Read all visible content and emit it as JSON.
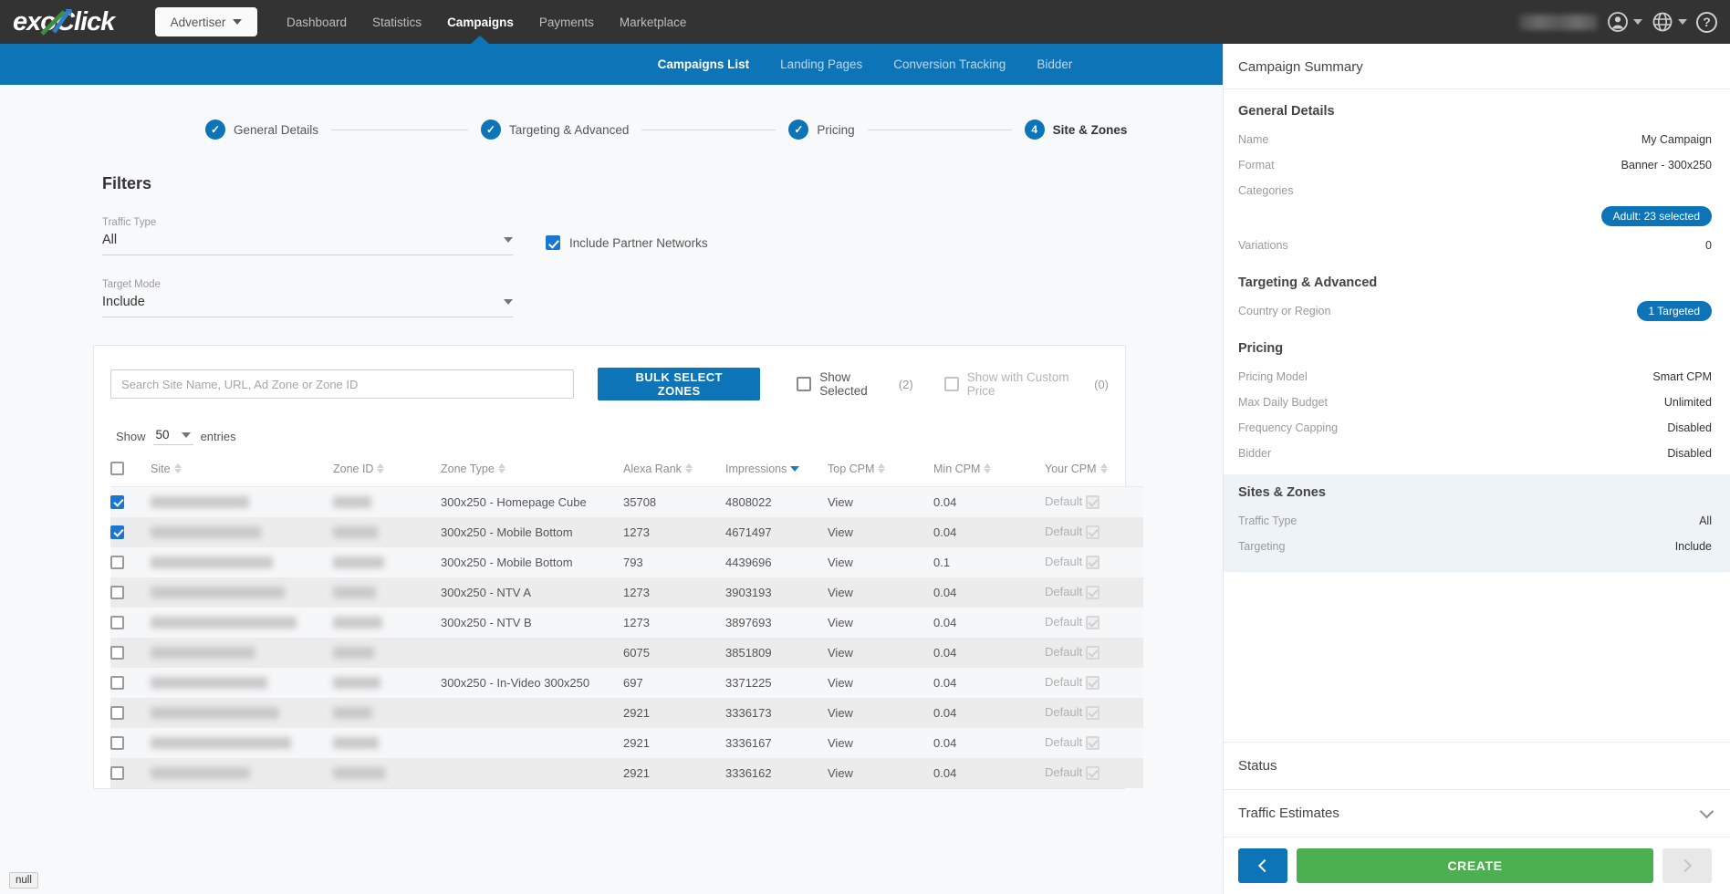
{
  "brand": {
    "logo_text": "exoClick",
    "accent": "#0d74b8",
    "create_green": "#4caf50"
  },
  "topbar": {
    "account_type": "Advertiser",
    "nav": [
      {
        "label": "Dashboard",
        "active": false
      },
      {
        "label": "Statistics",
        "active": false
      },
      {
        "label": "Campaigns",
        "active": true
      },
      {
        "label": "Payments",
        "active": false
      },
      {
        "label": "Marketplace",
        "active": false
      }
    ],
    "user_name_redacted": "",
    "icons": {
      "account": "account-circle-icon",
      "language": "globe-icon",
      "help": "help-circle-icon"
    }
  },
  "subnav": {
    "tabs": [
      {
        "label": "Campaigns List",
        "active": true
      },
      {
        "label": "Landing Pages",
        "active": false
      },
      {
        "label": "Conversion Tracking",
        "active": false
      },
      {
        "label": "Bidder",
        "active": false
      }
    ]
  },
  "stepper": {
    "steps": [
      {
        "label": "General Details",
        "state": "complete",
        "mark": "✓"
      },
      {
        "label": "Targeting & Advanced",
        "state": "complete",
        "mark": "✓"
      },
      {
        "label": "Pricing",
        "state": "complete",
        "mark": "✓"
      },
      {
        "label": "Site & Zones",
        "state": "active",
        "mark": "4"
      }
    ]
  },
  "filters": {
    "title": "Filters",
    "traffic_type": {
      "label": "Traffic Type",
      "value": "All"
    },
    "target_mode": {
      "label": "Target Mode",
      "value": "Include"
    },
    "include_partner_networks": {
      "label": "Include Partner Networks",
      "checked": true
    }
  },
  "zones_card": {
    "search": {
      "placeholder": "Search Site Name, URL, Ad Zone or Zone ID",
      "value": ""
    },
    "bulk_button": "BULK SELECT ZONES",
    "show_selected": {
      "label": "Show Selected",
      "count": "(2)",
      "checked": false
    },
    "show_custom_price": {
      "label": "Show with Custom Price",
      "count": "(0)",
      "checked": false
    },
    "show_entries": {
      "prefix": "Show",
      "value": "50",
      "suffix": "entries"
    },
    "columns": [
      {
        "key": "checkbox",
        "label": ""
      },
      {
        "key": "site",
        "label": "Site",
        "sort": "none"
      },
      {
        "key": "zone_id",
        "label": "Zone ID",
        "sort": "none"
      },
      {
        "key": "zone_type",
        "label": "Zone Type",
        "sort": "none"
      },
      {
        "key": "alexa_rank",
        "label": "Alexa Rank",
        "sort": "none"
      },
      {
        "key": "impressions",
        "label": "Impressions",
        "sort": "desc"
      },
      {
        "key": "top_cpm",
        "label": "Top CPM",
        "sort": "none"
      },
      {
        "key": "min_cpm",
        "label": "Min CPM",
        "sort": "none"
      },
      {
        "key": "your_cpm",
        "label": "Your CPM",
        "sort": "none"
      }
    ],
    "rows": [
      {
        "selected": true,
        "site": "",
        "zone_id": "",
        "zone_type": "300x250 - Homepage Cube",
        "alexa_rank": "35708",
        "impressions": "4808022",
        "top_cpm": "View",
        "min_cpm": "0.04",
        "your_cpm": "Default"
      },
      {
        "selected": true,
        "site": "",
        "zone_id": "",
        "zone_type": "300x250 - Mobile Bottom",
        "alexa_rank": "1273",
        "impressions": "4671497",
        "top_cpm": "View",
        "min_cpm": "0.04",
        "your_cpm": "Default"
      },
      {
        "selected": false,
        "site": "",
        "zone_id": "",
        "zone_type": "300x250 - Mobile Bottom",
        "alexa_rank": "793",
        "impressions": "4439696",
        "top_cpm": "View",
        "min_cpm": "0.1",
        "your_cpm": "Default"
      },
      {
        "selected": false,
        "site": "",
        "zone_id": "",
        "zone_type": "300x250 - NTV A",
        "alexa_rank": "1273",
        "impressions": "3903193",
        "top_cpm": "View",
        "min_cpm": "0.04",
        "your_cpm": "Default"
      },
      {
        "selected": false,
        "site": "",
        "zone_id": "",
        "zone_type": "300x250 - NTV B",
        "alexa_rank": "1273",
        "impressions": "3897693",
        "top_cpm": "View",
        "min_cpm": "0.04",
        "your_cpm": "Default"
      },
      {
        "selected": false,
        "site": "",
        "zone_id": "",
        "zone_type": "",
        "alexa_rank": "6075",
        "impressions": "3851809",
        "top_cpm": "View",
        "min_cpm": "0.04",
        "your_cpm": "Default"
      },
      {
        "selected": false,
        "site": "",
        "zone_id": "",
        "zone_type": "300x250 - In-Video 300x250",
        "alexa_rank": "697",
        "impressions": "3371225",
        "top_cpm": "View",
        "min_cpm": "0.04",
        "your_cpm": "Default"
      },
      {
        "selected": false,
        "site": "",
        "zone_id": "",
        "zone_type": "",
        "alexa_rank": "2921",
        "impressions": "3336173",
        "top_cpm": "View",
        "min_cpm": "0.04",
        "your_cpm": "Default"
      },
      {
        "selected": false,
        "site": "",
        "zone_id": "",
        "zone_type": "",
        "alexa_rank": "2921",
        "impressions": "3336167",
        "top_cpm": "View",
        "min_cpm": "0.04",
        "your_cpm": "Default"
      },
      {
        "selected": false,
        "site": "",
        "zone_id": "",
        "zone_type": "",
        "alexa_rank": "2921",
        "impressions": "3336162",
        "top_cpm": "View",
        "min_cpm": "0.04",
        "your_cpm": "Default"
      }
    ]
  },
  "sidebar": {
    "title": "Campaign Summary",
    "general_details": {
      "heading": "General Details",
      "name_label": "Name",
      "name_value": "My Campaign",
      "format_label": "Format",
      "format_value": "Banner - 300x250",
      "categories_label": "Categories",
      "categories_badge": "Adult: 23 selected",
      "variations_label": "Variations",
      "variations_value": "0"
    },
    "targeting": {
      "heading": "Targeting & Advanced",
      "country_label": "Country or Region",
      "country_badge": "1 Targeted"
    },
    "pricing": {
      "heading": "Pricing",
      "rows": [
        {
          "label": "Pricing Model",
          "value": "Smart CPM"
        },
        {
          "label": "Max Daily Budget",
          "value": "Unlimited"
        },
        {
          "label": "Frequency Capping",
          "value": "Disabled"
        },
        {
          "label": "Bidder",
          "value": "Disabled"
        }
      ]
    },
    "sites_zones": {
      "heading": "Sites & Zones",
      "rows": [
        {
          "label": "Traffic Type",
          "value": "All"
        },
        {
          "label": "Targeting",
          "value": "Include"
        }
      ]
    },
    "status_heading": "Status",
    "traffic_estimates_heading": "Traffic Estimates",
    "actions": {
      "prev": "previous-step",
      "create": "CREATE",
      "next": "next-step"
    }
  },
  "status_tip": "null"
}
